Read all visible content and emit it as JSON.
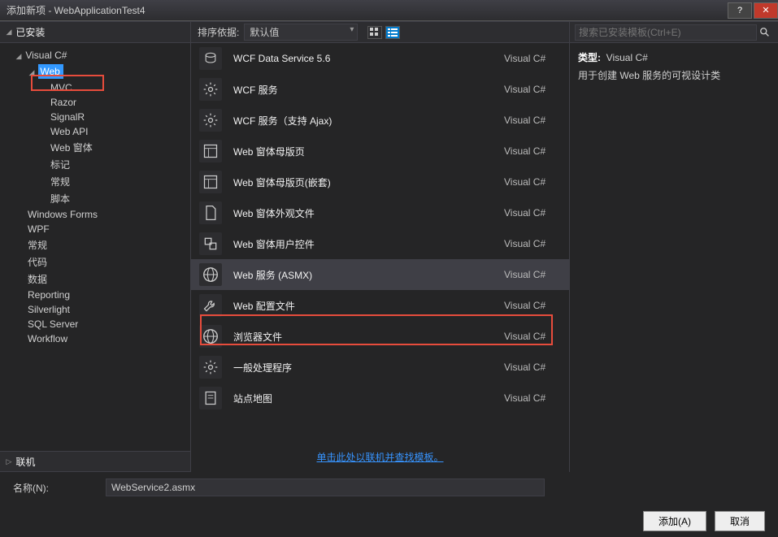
{
  "window": {
    "title": "添加新项 - WebApplicationTest4"
  },
  "tree": {
    "installed_label": "已安装",
    "online_label": "联机",
    "nodes": [
      {
        "label": "Visual C#",
        "indent": 1,
        "arrow": "◢"
      },
      {
        "label": "Web",
        "indent": 2,
        "arrow": "◢",
        "selected": true
      },
      {
        "label": "MVC",
        "indent": 3
      },
      {
        "label": "Razor",
        "indent": 3
      },
      {
        "label": "SignalR",
        "indent": 3
      },
      {
        "label": "Web API",
        "indent": 3
      },
      {
        "label": "Web 窗体",
        "indent": 3
      },
      {
        "label": "标记",
        "indent": 3
      },
      {
        "label": "常规",
        "indent": 3
      },
      {
        "label": "脚本",
        "indent": 3
      },
      {
        "label": "Windows Forms",
        "indent": 2
      },
      {
        "label": "WPF",
        "indent": 2
      },
      {
        "label": "常规",
        "indent": 2
      },
      {
        "label": "代码",
        "indent": 2
      },
      {
        "label": "数据",
        "indent": 2
      },
      {
        "label": "Reporting",
        "indent": 2
      },
      {
        "label": "Silverlight",
        "indent": 2
      },
      {
        "label": "SQL Server",
        "indent": 2
      },
      {
        "label": "Workflow",
        "indent": 2
      }
    ]
  },
  "sort": {
    "label": "排序依据:",
    "value": "默认值"
  },
  "items": [
    {
      "label": "WCF Data Service 5.6",
      "lang": "Visual C#",
      "icon": "wcf"
    },
    {
      "label": "WCF 服务",
      "lang": "Visual C#",
      "icon": "gear"
    },
    {
      "label": "WCF 服务（支持 Ajax)",
      "lang": "Visual C#",
      "icon": "gear"
    },
    {
      "label": "Web 窗体母版页",
      "lang": "Visual C#",
      "icon": "master"
    },
    {
      "label": "Web 窗体母版页(嵌套)",
      "lang": "Visual C#",
      "icon": "master2"
    },
    {
      "label": "Web 窗体外观文件",
      "lang": "Visual C#",
      "icon": "file"
    },
    {
      "label": "Web 窗体用户控件",
      "lang": "Visual C#",
      "icon": "control"
    },
    {
      "label": "Web 服务 (ASMX)",
      "lang": "Visual C#",
      "icon": "globe",
      "selected": true
    },
    {
      "label": "Web 配置文件",
      "lang": "Visual C#",
      "icon": "wrench"
    },
    {
      "label": "浏览器文件",
      "lang": "Visual C#",
      "icon": "globe"
    },
    {
      "label": "一般处理程序",
      "lang": "Visual C#",
      "icon": "gear2"
    },
    {
      "label": "站点地图",
      "lang": "Visual C#",
      "icon": "sitemap"
    }
  ],
  "online_link": "单击此处以联机并查找模板。",
  "search": {
    "placeholder": "搜索已安装模板(Ctrl+E)"
  },
  "info": {
    "type_label": "类型:",
    "type_value": "Visual C#",
    "description": "用于创建 Web 服务的可视设计类"
  },
  "bottom": {
    "name_label": "名称(N):",
    "name_value": "WebService2.asmx",
    "add_btn": "添加(A)",
    "cancel_btn": "取消"
  }
}
